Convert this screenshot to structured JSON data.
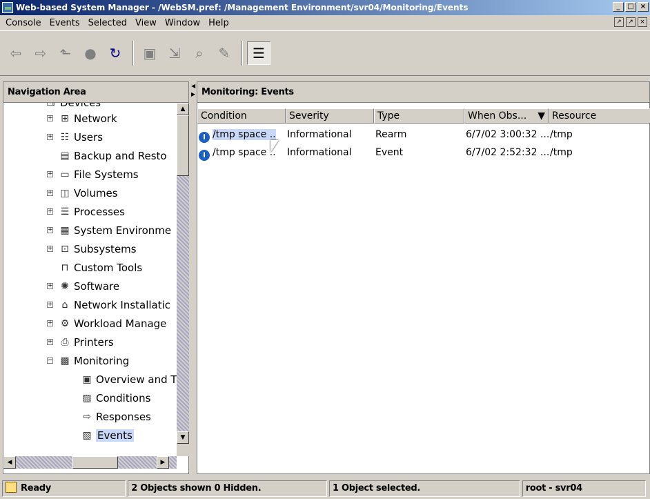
{
  "window": {
    "title": "Web-based System Manager - /WebSM.pref: /Management Environment/svr04/Monitoring/Events",
    "min": "_",
    "max": "□",
    "close": "×"
  },
  "menubar": {
    "items": [
      "Console",
      "Events",
      "Selected",
      "View",
      "Window",
      "Help"
    ]
  },
  "toolbar": {
    "buttons": [
      "back-icon",
      "forward-icon",
      "up-level-icon",
      "stop-icon",
      "refresh-icon",
      "find-icon",
      "export-icon",
      "search-icon",
      "edit-icon",
      "properties-icon"
    ]
  },
  "nav": {
    "header": "Navigation Area",
    "items": [
      {
        "label": "Devices",
        "icon": "devices-icon"
      },
      {
        "label": "Network",
        "icon": "network-icon"
      },
      {
        "label": "Users",
        "icon": "users-icon"
      },
      {
        "label": "Backup and Resto",
        "icon": "backup-icon"
      },
      {
        "label": "File Systems",
        "icon": "folder-icon"
      },
      {
        "label": "Volumes",
        "icon": "volumes-icon"
      },
      {
        "label": "Processes",
        "icon": "processes-icon"
      },
      {
        "label": "System Environme",
        "icon": "system-icon"
      },
      {
        "label": "Subsystems",
        "icon": "subsystems-icon"
      },
      {
        "label": "Custom Tools",
        "icon": "tools-icon"
      },
      {
        "label": "Software",
        "icon": "software-icon"
      },
      {
        "label": "Network Installatic",
        "icon": "install-icon"
      },
      {
        "label": "Workload Manage",
        "icon": "workload-icon"
      },
      {
        "label": "Printers",
        "icon": "printer-icon"
      },
      {
        "label": "Monitoring",
        "icon": "monitor-icon"
      },
      {
        "label": "Overview and T",
        "icon": "overview-icon"
      },
      {
        "label": "Conditions",
        "icon": "conditions-icon"
      },
      {
        "label": "Responses",
        "icon": "responses-icon"
      },
      {
        "label": "Events",
        "icon": "events-icon"
      }
    ]
  },
  "main": {
    "header": "Monitoring: Events",
    "columns": [
      "Condition",
      "Severity",
      "Type",
      "When Obs...",
      "Resource"
    ],
    "sort_indicator": "▼",
    "rows": [
      [
        "/tmp space ..",
        "Informational",
        "Rearm",
        "6/7/02 3:00:32 ...",
        "/tmp"
      ],
      [
        "/tmp space ..",
        "Informational",
        "Event",
        "6/7/02 2:52:32 ...",
        "/tmp"
      ]
    ]
  },
  "status": {
    "ready": "Ready",
    "objects": "2 Objects shown 0 Hidden.",
    "selected": "1 Object selected.",
    "user": "root - svr04"
  }
}
